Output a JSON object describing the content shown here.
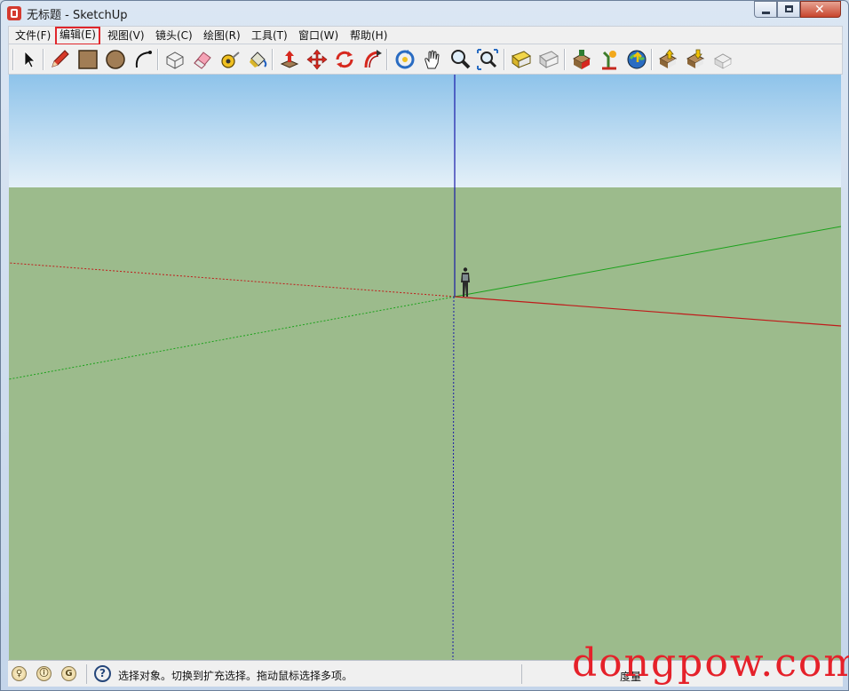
{
  "window": {
    "title": "无标题 - SketchUp"
  },
  "menu": [
    {
      "label": "文件(F)"
    },
    {
      "label": "编辑(E)"
    },
    {
      "label": "视图(V)"
    },
    {
      "label": "镜头(C)"
    },
    {
      "label": "绘图(R)"
    },
    {
      "label": "工具(T)"
    },
    {
      "label": "窗口(W)"
    },
    {
      "label": "帮助(H)"
    }
  ],
  "highlighted_menu": "编辑(E)",
  "toolbar": {
    "tools": [
      "select-icon",
      "pencil-icon",
      "rectangle-icon",
      "circle-icon",
      "arc-icon",
      "make-component-icon",
      "eraser-icon",
      "tape-measure-icon",
      "paint-bucket-icon",
      "push-pull-icon",
      "move-icon",
      "rotate-icon",
      "follow-me-icon",
      "orbit-icon",
      "pan-icon",
      "zoom-icon",
      "zoom-extents-icon",
      "previous-view-icon",
      "next-view-icon",
      "3d-warehouse-icon",
      "get-models-icon",
      "google-earth-icon",
      "share-component-icon",
      "upload-icon",
      "extension-warehouse-icon"
    ]
  },
  "viewport": {
    "sky_color": "#8ec3ea",
    "ground_color": "#9cbb8c",
    "axes": {
      "red": "#c01a1a",
      "green": "#1aa11a",
      "blue": "#1a1aa8"
    }
  },
  "status": {
    "tips": [
      "geo-location-icon",
      "credits-icon",
      "account-icon"
    ],
    "help_label": "?",
    "message": "选择对象。切换到扩充选择。拖动鼠标选择多项。",
    "measure_label": "度量"
  },
  "watermark": "dongpow.com"
}
